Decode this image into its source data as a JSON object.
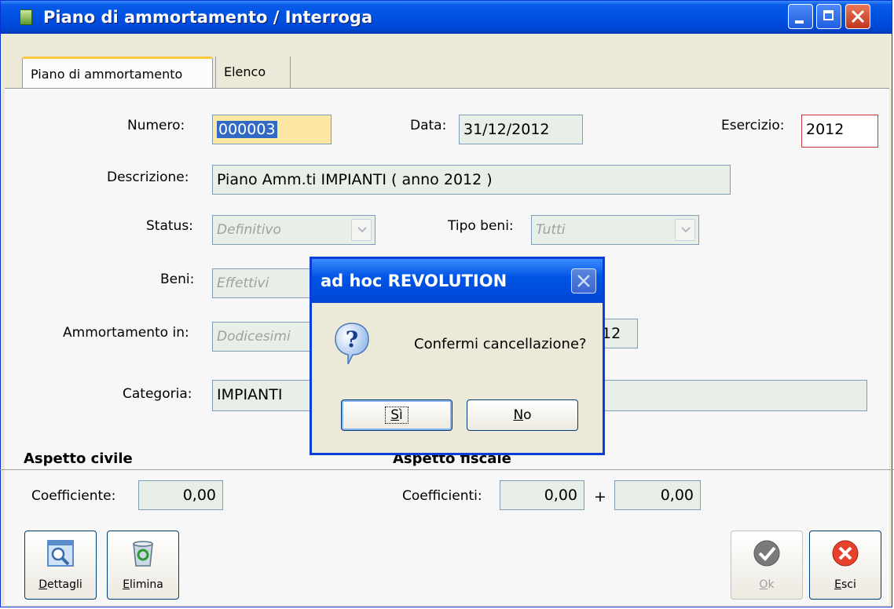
{
  "window": {
    "title": "Piano di ammortamento / Interroga"
  },
  "tabs": [
    {
      "label": "Piano di ammortamento",
      "active": true
    },
    {
      "label": "Elenco",
      "active": false
    }
  ],
  "form": {
    "numero_label": "Numero:",
    "numero_value": "000003",
    "data_label": "Data:",
    "data_value": "31/12/2012",
    "esercizio_label": "Esercizio:",
    "esercizio_value": "2012",
    "descrizione_label": "Descrizione:",
    "descrizione_value": "Piano Amm.ti  IMPIANTI ( anno 2012 )",
    "status_label": "Status:",
    "status_value": "Definitivo",
    "tipo_beni_label": "Tipo beni:",
    "tipo_beni_value": "Tutti",
    "beni_label": "Beni:",
    "beni_value": "Effettivi",
    "ammortamento_label": "Ammortamento in:",
    "ammortamento_value": "Dodicesimi",
    "hidden_field_value": "12",
    "categoria_label": "Categoria:",
    "categoria_value": "IMPIANTI"
  },
  "sections": {
    "civile_title": "Aspetto civile",
    "fiscale_title": "Aspetto fiscale",
    "coefficiente_label": "Coefficiente:",
    "coefficiente_value": "0,00",
    "coefficienti_label": "Coefficienti:",
    "coefficienti_value1": "0,00",
    "plus_sign": "+",
    "coefficienti_value2": "0,00"
  },
  "buttons": {
    "dettagli_hotkey": "D",
    "dettagli_rest": "ettagli",
    "elimina_hotkey": "E",
    "elimina_rest": "limina",
    "ok_hotkey": "O",
    "ok_rest": "k",
    "esci_hotkey": "E",
    "esci_rest": "sci"
  },
  "dialog": {
    "title": "ad hoc REVOLUTION",
    "message": "Confermi cancellazione?",
    "yes_hotkey": "S",
    "yes_rest": "ì",
    "no_hotkey": "N",
    "no_rest": "o"
  },
  "colors": {
    "titlebar": "#0055e5",
    "selected_field": "#fde7a4",
    "focus_border": "#c73a3a",
    "close_red": "#c0361c"
  },
  "icons": [
    "window-app-icon",
    "minimize-icon",
    "maximize-icon",
    "close-icon",
    "magnifier-icon",
    "recycle-bin-icon",
    "checkmark-icon",
    "exit-icon",
    "question-icon",
    "dropdown-arrow-icon"
  ]
}
